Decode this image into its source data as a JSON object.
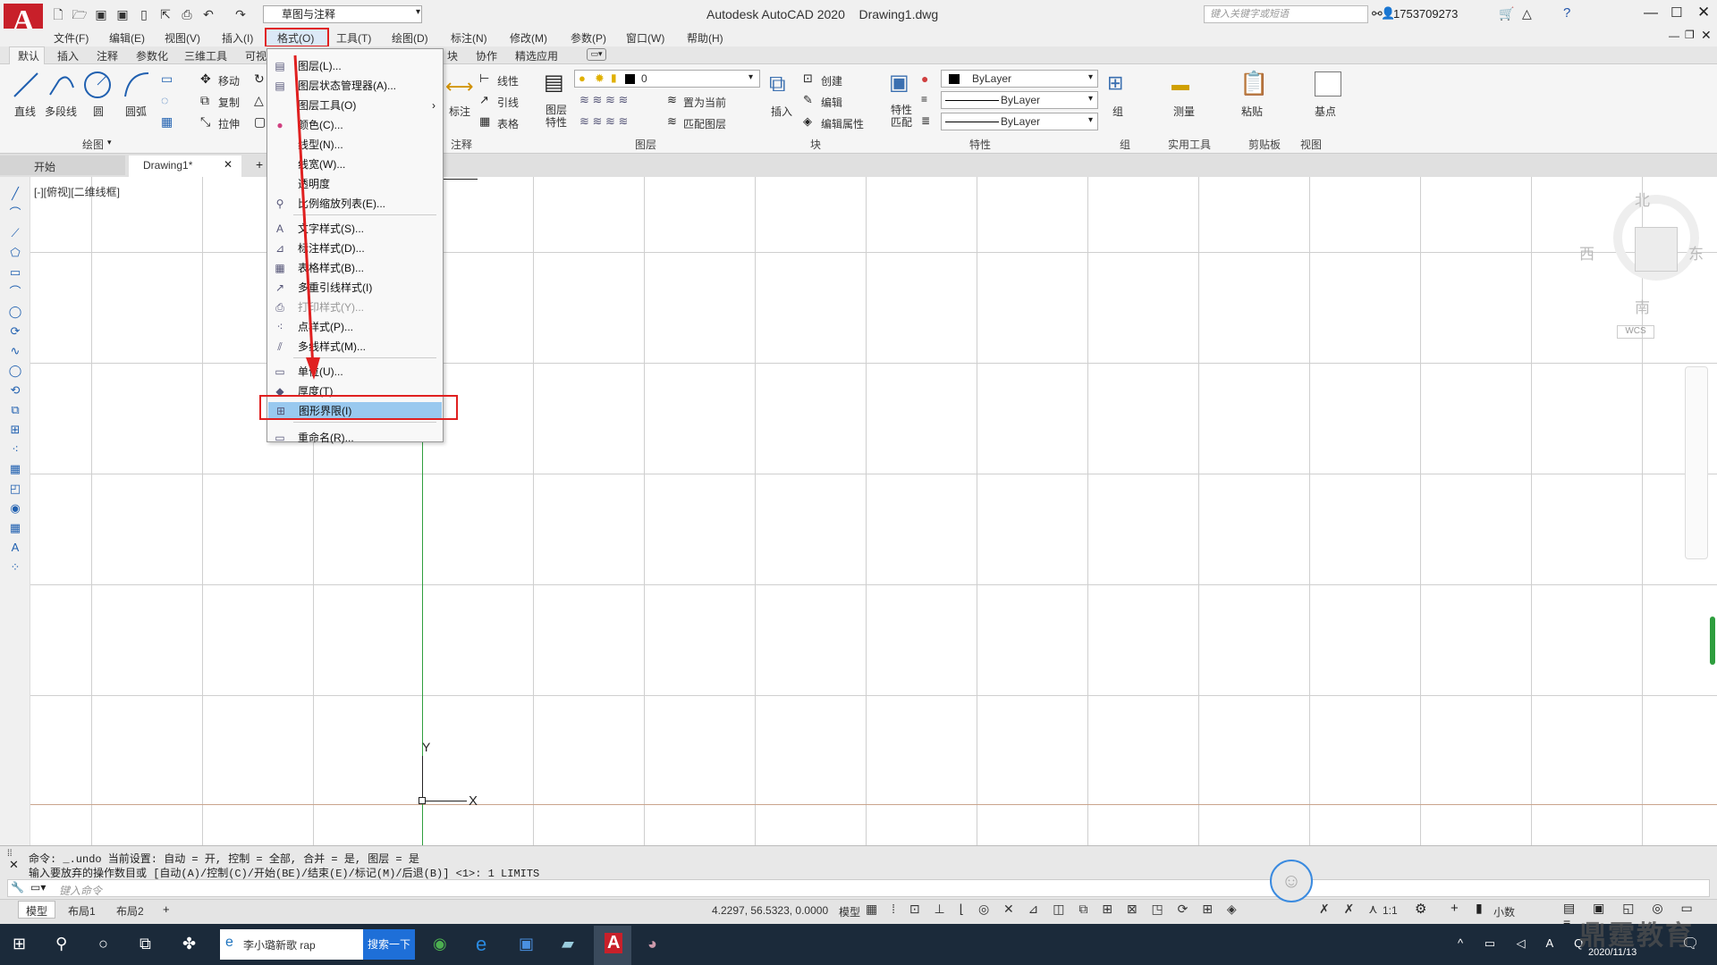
{
  "titlebar": {
    "workspace": "草图与注释",
    "app_title": "Autodesk AutoCAD 2020",
    "doc_title": "Drawing1.dwg",
    "search_placeholder": "键入关键字或短语",
    "user": "1753709273"
  },
  "menubar": [
    "文件(F)",
    "编辑(E)",
    "视图(V)",
    "插入(I)",
    "格式(O)",
    "工具(T)",
    "绘图(D)",
    "标注(N)",
    "修改(M)",
    "参数(P)",
    "窗口(W)",
    "帮助(H)"
  ],
  "ribbon_tabs": [
    "默认",
    "插入",
    "注释",
    "参数化",
    "三维工具",
    "可视",
    "块",
    "协作",
    "精选应用"
  ],
  "ribbon": {
    "draw": {
      "line": "直线",
      "polyline": "多段线",
      "circle": "圆",
      "arc": "圆弧",
      "panel": "绘图"
    },
    "modify": {
      "move": "移动",
      "copy": "复制",
      "stretch": "拉伸"
    },
    "annotation": {
      "dim": "标注",
      "linear": "线性",
      "leader": "引线",
      "table": "表格",
      "panel": "注释"
    },
    "layers": {
      "props": "图层特性",
      "layer_value": "0",
      "set_current": "置为当前",
      "match": "匹配图层",
      "panel": "图层"
    },
    "block": {
      "insert": "插入",
      "create": "创建",
      "edit": "编辑",
      "edit_attr": "编辑属性",
      "panel": "块"
    },
    "properties": {
      "match": "特性匹配",
      "color": "ByLayer",
      "linetype": "ByLayer",
      "lineweight": "ByLayer",
      "panel": "特性"
    },
    "group": {
      "label": "组",
      "panel": "组"
    },
    "utilities": {
      "measure": "测量",
      "panel": "实用工具"
    },
    "clipboard": {
      "paste": "粘贴",
      "panel": "剪贴板"
    },
    "view": {
      "base": "基点",
      "panel": "视图"
    }
  },
  "doc_tabs": {
    "start": "开始",
    "drawing": "Drawing1*",
    "close": "✕",
    "add": "+"
  },
  "viewport": {
    "label": "[-][俯视][二维线框]",
    "ucs_y": "Y",
    "ucs_x": "X",
    "compass": {
      "n": "北",
      "s": "南",
      "e": "东",
      "w": "西"
    },
    "wcs": "WCS"
  },
  "format_menu": [
    {
      "label": "图层(L)...",
      "icon": "layers-icon",
      "glyph": "▤"
    },
    {
      "label": "图层状态管理器(A)...",
      "icon": "layer-state-icon",
      "glyph": "▤"
    },
    {
      "label": "图层工具(O)",
      "icon": "",
      "glyph": "",
      "submenu": true
    },
    {
      "label": "颜色(C)...",
      "icon": "color-wheel-icon",
      "glyph": "●"
    },
    {
      "label": "线型(N)...",
      "icon": "",
      "glyph": ""
    },
    {
      "label": "线宽(W)...",
      "icon": "",
      "glyph": ""
    },
    {
      "label": "透明度",
      "icon": "",
      "glyph": ""
    },
    {
      "label": "比例缩放列表(E)...",
      "icon": "scale-list-icon",
      "glyph": "⚲"
    },
    {
      "label": "文字样式(S)...",
      "icon": "text-style-icon",
      "glyph": "A"
    },
    {
      "label": "标注样式(D)...",
      "icon": "dim-style-icon",
      "glyph": "⊿"
    },
    {
      "label": "表格样式(B)...",
      "icon": "table-style-icon",
      "glyph": "▦"
    },
    {
      "label": "多重引线样式(I)",
      "icon": "mleader-style-icon",
      "glyph": "↗"
    },
    {
      "label": "打印样式(Y)...",
      "icon": "plot-style-icon",
      "glyph": "⎙",
      "disabled": true
    },
    {
      "label": "点样式(P)...",
      "icon": "point-style-icon",
      "glyph": "⁖"
    },
    {
      "label": "多线样式(M)...",
      "icon": "mline-style-icon",
      "glyph": "⫽"
    },
    {
      "label": "单位(U)...",
      "icon": "units-icon",
      "glyph": "▭"
    },
    {
      "label": "厚度(T)",
      "icon": "thickness-icon",
      "glyph": "◆"
    },
    {
      "label": "图形界限(I)",
      "icon": "limits-icon",
      "glyph": "⊞",
      "highlighted": true
    },
    {
      "label": "重命名(R)...",
      "icon": "rename-icon",
      "glyph": "▭"
    }
  ],
  "command": {
    "line1": "命令: _.undo 当前设置: 自动 = 开, 控制 = 全部, 合并 = 是, 图层 = 是",
    "line2": "输入要放弃的操作数目或 [自动(A)/控制(C)/开始(BE)/结束(E)/标记(M)/后退(B)] <1>: 1 LIMITS",
    "placeholder": "键入命令"
  },
  "status": {
    "model_tab": "模型",
    "layout1": "布局1",
    "layout2": "布局2",
    "add": "+",
    "coords": "4.2297, 56.5323, 0.0000",
    "model": "模型",
    "scale": "1:1",
    "units": "小数"
  },
  "taskbar": {
    "browser_tab": "李小璐新歌 rap",
    "search_btn": "搜索一下",
    "date": "2020/11/13",
    "watermark": "鼎霆教育"
  },
  "colors": {
    "highlight_box": "#e02020",
    "menu_highlight": "#99c9ef",
    "logo": "#c8202a",
    "ucs_green": "#2e9e3e"
  }
}
